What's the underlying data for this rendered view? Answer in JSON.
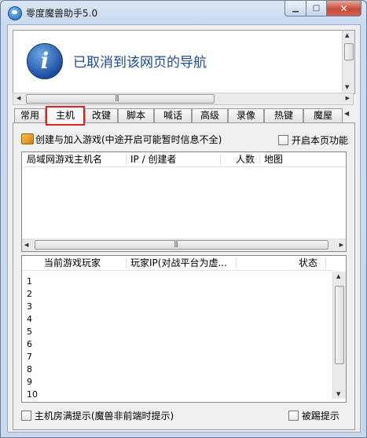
{
  "window": {
    "title": "零度魔兽助手5.0"
  },
  "nav_error": {
    "message": "已取消到该网页的导航"
  },
  "tabs": [
    {
      "label": "常用"
    },
    {
      "label": "主机"
    },
    {
      "label": "改键"
    },
    {
      "label": "脚本"
    },
    {
      "label": "喊话"
    },
    {
      "label": "高级"
    },
    {
      "label": "录像"
    },
    {
      "label": "热键"
    },
    {
      "label": "魔屋"
    }
  ],
  "host": {
    "create_label": "创建与加入游戏(中途开启可能暂时信息不全)",
    "enable_label": "开启本页功能",
    "host_list": {
      "columns": [
        "局域网游戏主机名",
        "IP / 创建者",
        "人数",
        "地图"
      ]
    },
    "player_list": {
      "columns": [
        "当前游戏玩家",
        "玩家IP(对战平台为虚...",
        "状态"
      ],
      "rows": [
        "1",
        "2",
        "3",
        "4",
        "5",
        "6",
        "7",
        "8",
        "9",
        "10"
      ]
    },
    "room_full_label": "主机房满提示(魔兽非前端时提示)",
    "kicked_label": "被踢提示"
  }
}
